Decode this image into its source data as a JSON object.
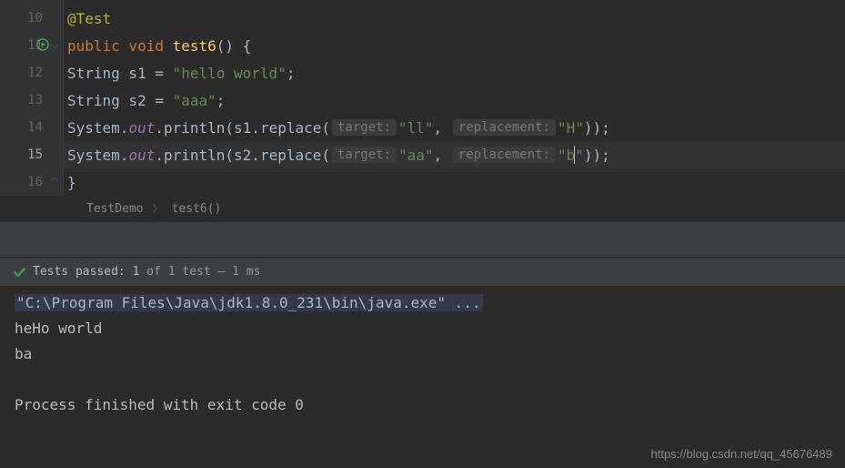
{
  "gutter": {
    "lines": [
      "10",
      "11",
      "12",
      "13",
      "14",
      "15",
      "16"
    ],
    "activeLine": "15"
  },
  "code": {
    "l10_ann": "@Test",
    "l11_kw1": "public void ",
    "l11_mth": "test6",
    "l11_tail": "() {",
    "l12_a": "String s1 = ",
    "l12_str": "\"hello world\"",
    "l12_semi": ";",
    "l13_a": "String s2 = ",
    "l13_str": "\"aaa\"",
    "l13_semi": ";",
    "l14_sys": "System.",
    "l14_out": "out",
    "l14_dot": ".println(s1.replace(",
    "l14_hint1": "target:",
    "l14_str1": "\"ll\"",
    "l14_comma": ", ",
    "l14_hint2": "replacement:",
    "l14_str2": "\"H\"",
    "l14_end": "));",
    "l15_sys": "System.",
    "l15_out": "out",
    "l15_dot": ".println(s2.replace(",
    "l15_hint1": "target:",
    "l15_str1": "\"aa\"",
    "l15_comma": ", ",
    "l15_hint2": "replacement:",
    "l15_str2a": "\"b",
    "l15_str2b": "\"",
    "l15_end": "));",
    "l16": "}"
  },
  "breadcrumb": {
    "class": "TestDemo",
    "method": "test6()"
  },
  "testStatus": {
    "prefix": "Tests passed:",
    "count": "1",
    "suffix": "of 1 test – 1 ms"
  },
  "console": {
    "cmd": "\"C:\\Program Files\\Java\\jdk1.8.0_231\\bin\\java.exe\" ...",
    "out1": "heHo world",
    "out2": "ba",
    "exit": "Process finished with exit code 0"
  },
  "watermark": "https://blog.csdn.net/qq_45676489"
}
